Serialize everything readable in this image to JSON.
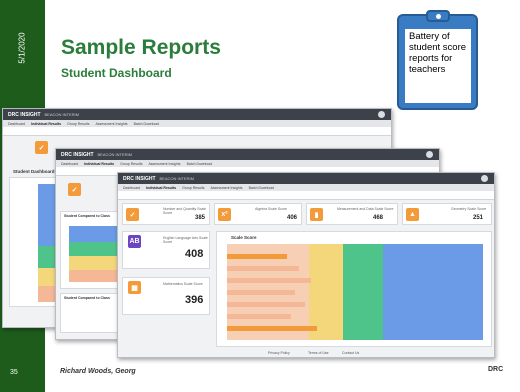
{
  "slide": {
    "date": "5/1/2020",
    "title": "Sample Reports",
    "subtitle": "Student Dashboard",
    "page_number": "35",
    "footer_author": "Richard Woods, Georg",
    "footer_logo": "DRC"
  },
  "callout": {
    "text": "Battery of student score reports for teachers"
  },
  "app": {
    "brand": "DRC INSIGHT",
    "brand_suffix": "BEACON INTERIM",
    "tabs": [
      "Dashboard",
      "Individual Results",
      "Group Results",
      "Assessment Insights",
      "Batch Download"
    ],
    "active_tab": "Individual Results"
  },
  "back_screen": {
    "title": "Student Dashboard"
  },
  "mid_screen": {
    "panel_title": "Student Compared to Class",
    "panel_title_2": "Student Compared to Class"
  },
  "front_screen": {
    "metrics": [
      {
        "label": "Number and Quantity Scale Score",
        "value": "385"
      },
      {
        "label": "Algebra Scale Score",
        "value": "406"
      },
      {
        "label": "Measurement and Data Scale Score",
        "value": "468"
      },
      {
        "label": "Geometry Scale Score",
        "value": "251"
      }
    ],
    "side_cards": [
      {
        "label": "English Language Arts Scale Score",
        "value": "408"
      },
      {
        "label": "Mathematics Scale Score",
        "value": "396"
      }
    ],
    "chart_title": "Scale Score",
    "footer_links": [
      "Privacy Policy",
      "Terms of Use",
      "Contact Us"
    ]
  },
  "colors": {
    "sidebar": "#1e5c1c",
    "title": "#2a7d3a",
    "callout": "#3a7cc4",
    "accent_orange": "#f39a3a",
    "accent_purple": "#6b46c1",
    "band_salmon": "#f5b896",
    "band_yellow": "#f3d77a",
    "band_green": "#4fc48a",
    "band_blue": "#6b9be6"
  }
}
